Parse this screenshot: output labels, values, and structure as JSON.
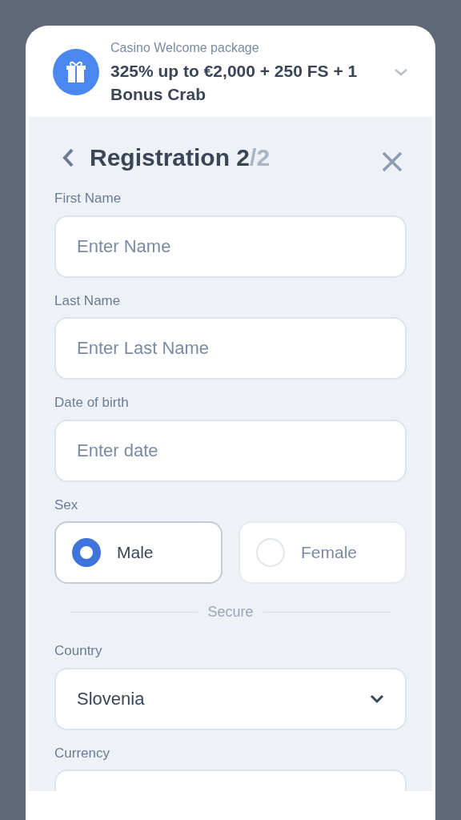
{
  "promo": {
    "caption": "Casino Welcome package",
    "offer": "325% up to €2,000 + 250 FS + 1 Bonus Crab",
    "expanded": false
  },
  "header": {
    "title": "Registration 2",
    "step_total": "/2"
  },
  "fields": [
    {
      "kind": "text",
      "label": "First Name",
      "placeholder": "Enter Name"
    },
    {
      "kind": "text",
      "label": "Last Name",
      "placeholder": "Enter Last Name"
    },
    {
      "kind": "text",
      "label": "Date of birth",
      "placeholder": "Enter date"
    },
    {
      "kind": "radio",
      "label": "Sex",
      "options": [
        {
          "label": "Male",
          "selected": true
        },
        {
          "label": "Female",
          "selected": false
        }
      ]
    },
    {
      "kind": "divider",
      "label": "Secure"
    },
    {
      "kind": "select",
      "label": "Country",
      "value": "Slovenia"
    },
    {
      "kind": "select_cut",
      "label": "Currency"
    }
  ]
}
